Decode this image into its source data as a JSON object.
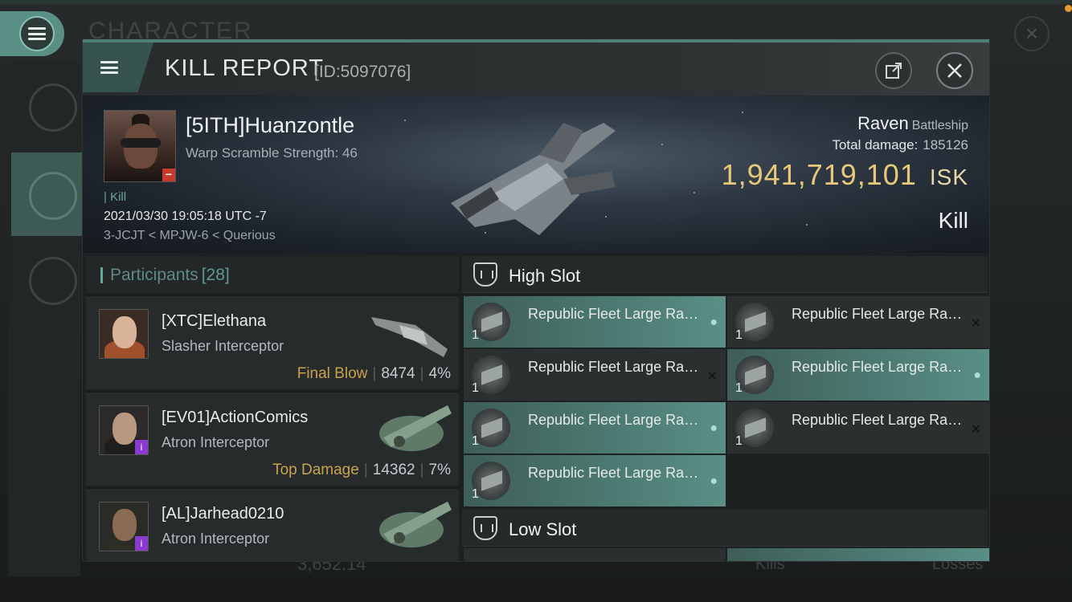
{
  "background": {
    "title": "CHARACTER",
    "bottom_value": "3,652.14",
    "bottom_kills": "Kills",
    "bottom_losses": "Losses"
  },
  "header": {
    "title": "KILL REPORT",
    "id": "[ID:5097076]",
    "share_icon": "share-icon",
    "close_icon": "close-icon"
  },
  "victim": {
    "name": "[5ITH]Huanzontle",
    "subtitle": "Warp Scramble Strength: 46",
    "tag": "| Kill",
    "datetime": "2021/03/30 19:05:18 UTC -7",
    "location": "3-JCJT < MPJW-6 < Querious",
    "ship": "Raven",
    "ship_class": "Battleship",
    "total_damage_label": "Total damage:",
    "total_damage": "185126",
    "isk_value": "1,941,719,101",
    "isk_unit": "ISK",
    "result": "Kill"
  },
  "participants": {
    "label": "Participants",
    "count": "[28]",
    "rows": [
      {
        "name": "[XTC]Elethana",
        "ship": "Slasher Interceptor",
        "tag": "Final Blow",
        "damage": "8474",
        "pct": "4%"
      },
      {
        "name": "[EV01]ActionComics",
        "ship": "Atron Interceptor",
        "tag": "Top Damage",
        "damage": "14362",
        "pct": "7%"
      },
      {
        "name": "[AL]Jarhead0210",
        "ship": "Atron Interceptor",
        "tag": "",
        "damage": "",
        "pct": ""
      }
    ]
  },
  "slots": {
    "high_label": "High Slot",
    "low_label": "Low Slot",
    "items": [
      {
        "name": "Republic Fleet Large Rapid...",
        "qty": "1"
      },
      {
        "name": "Republic Fleet Large Rapid...",
        "qty": "1"
      },
      {
        "name": "Republic Fleet Large Rapid...",
        "qty": "1"
      },
      {
        "name": "Republic Fleet Large Rapid...",
        "qty": "1"
      },
      {
        "name": "Republic Fleet Large Rapid...",
        "qty": "1"
      },
      {
        "name": "Republic Fleet Large Rapid...",
        "qty": "1"
      },
      {
        "name": "Republic Fleet Large Rapid...",
        "qty": "1"
      }
    ]
  },
  "colors": {
    "accent": "#5a8f86",
    "isk": "#e8c97a",
    "final_blow": "#c9a24f"
  }
}
